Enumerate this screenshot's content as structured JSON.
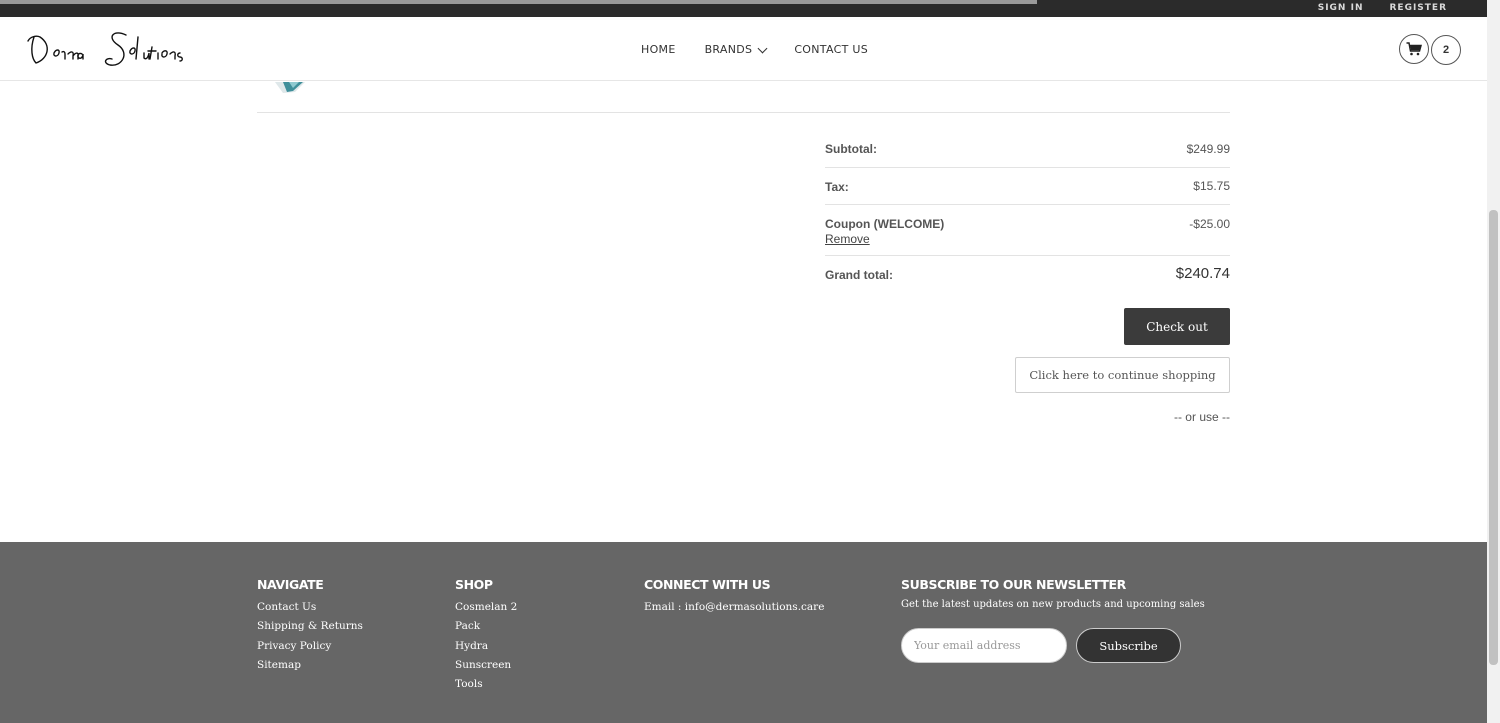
{
  "topbar": {
    "sign_in": "SIGN IN",
    "register": "REGISTER"
  },
  "header": {
    "logo_text": "Derma Solutions",
    "nav": {
      "home": "HOME",
      "brands": "BRANDS",
      "contact": "CONTACT US"
    },
    "cart_icon": "cart-icon",
    "cart_count": "2"
  },
  "totals": {
    "subtotal_label": "Subtotal:",
    "subtotal_value": "$249.99",
    "tax_label": "Tax:",
    "tax_value": "$15.75",
    "coupon_label": "Coupon (WELCOME)",
    "coupon_remove": "Remove",
    "coupon_value": "-$25.00",
    "grand_label": "Grand total:",
    "grand_value": "$240.74"
  },
  "actions": {
    "checkout": "Check out",
    "continue": "Click here to continue shopping",
    "or_use": "-- or use --"
  },
  "footer": {
    "navigate": {
      "title": "NAVIGATE",
      "links": [
        "Contact Us",
        "Shipping & Returns",
        "Privacy Policy",
        "Sitemap"
      ]
    },
    "shop": {
      "title": "SHOP",
      "links": [
        "Cosmelan 2",
        "Pack",
        "Hydra",
        "Sunscreen",
        "Tools"
      ]
    },
    "connect": {
      "title": "CONNECT WITH US",
      "email": "Email : info@dermasolutions.care"
    },
    "newsletter": {
      "title": "SUBSCRIBE TO OUR NEWSLETTER",
      "subtitle": "Get the latest updates on new products and upcoming sales",
      "placeholder": "Your email address",
      "button": "Subscribe"
    }
  },
  "colors": {
    "topbar": "#2b2b2b",
    "footer": "#666666",
    "button_dark": "#3b3b3b"
  }
}
